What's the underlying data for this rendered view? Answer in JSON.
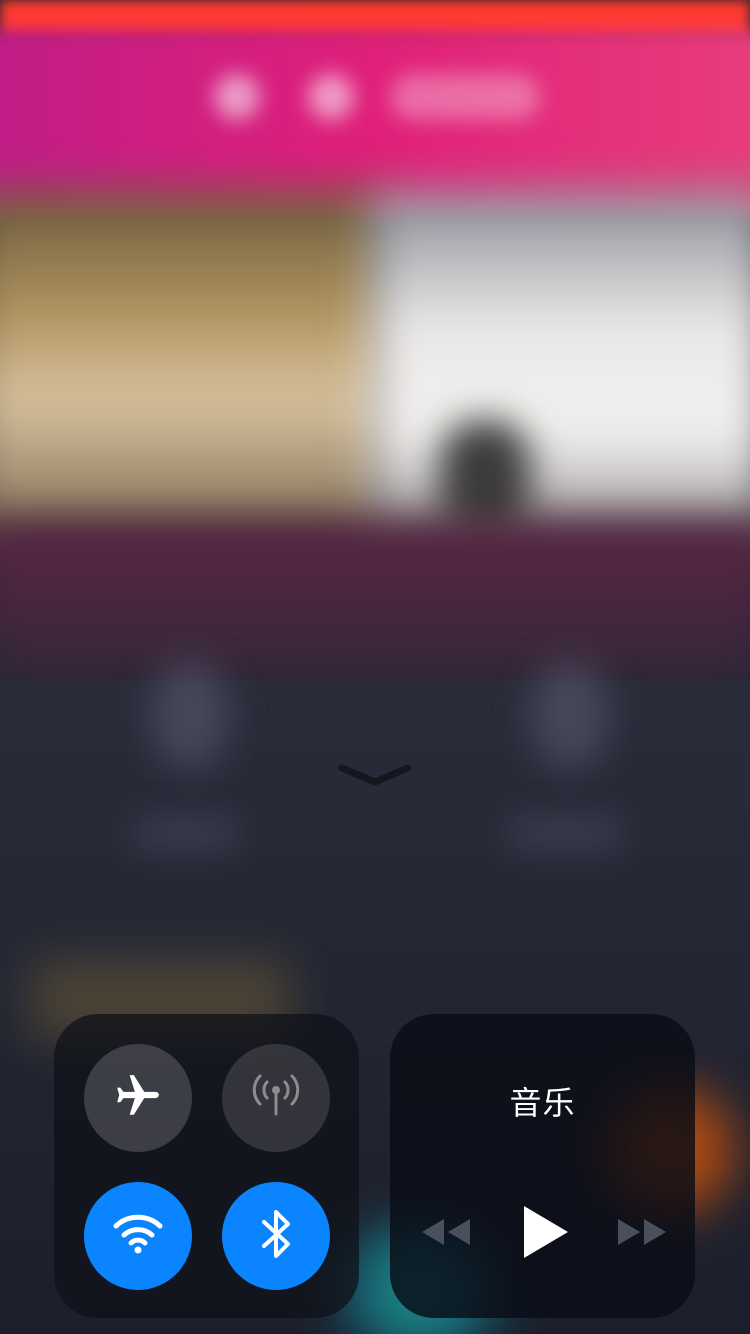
{
  "screen": {
    "type": "control-center",
    "dismiss_indicator": "chevron-down-icon"
  },
  "connectivity": {
    "airplane_mode": {
      "icon": "airplane-icon",
      "state": "off"
    },
    "cellular_data": {
      "icon": "cellular-antenna-icon",
      "state": "off"
    },
    "wifi": {
      "icon": "wifi-icon",
      "state": "on"
    },
    "bluetooth": {
      "icon": "bluetooth-icon",
      "state": "on"
    }
  },
  "music": {
    "title": "音乐",
    "controls": [
      {
        "icon": "rewind-icon",
        "enabled": false
      },
      {
        "icon": "play-icon",
        "enabled": true
      },
      {
        "icon": "fast-forward-icon",
        "enabled": false
      }
    ]
  },
  "colors": {
    "active_toggle": "#0a84ff",
    "background_accent_red": "#ff3b30",
    "background_accent_pink": "#e0207a"
  }
}
